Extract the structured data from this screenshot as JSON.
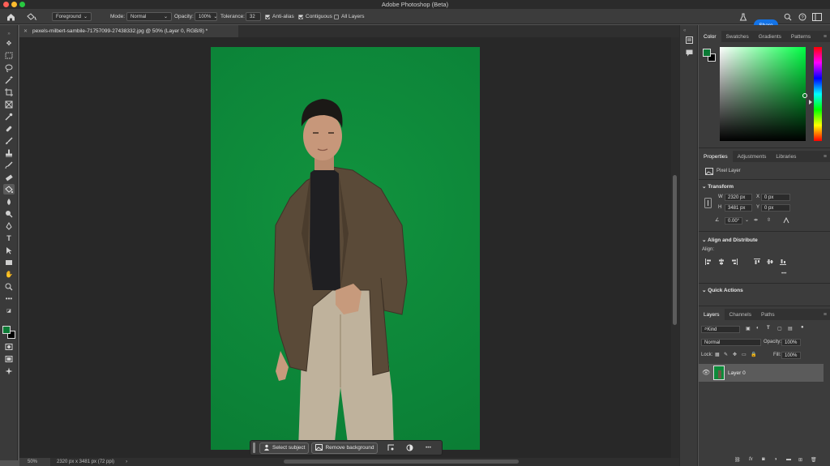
{
  "app": {
    "title": "Adobe Photoshop (Beta)"
  },
  "options": {
    "tool_preset": "Foreground",
    "mode_label": "Mode:",
    "mode_value": "Normal",
    "opacity_label": "Opacity:",
    "opacity_value": "100%",
    "tolerance_label": "Tolerance:",
    "tolerance_value": "32",
    "anti_alias": "Anti-alias",
    "contiguous": "Contiguous",
    "all_layers": "All Layers",
    "share": "Share"
  },
  "document": {
    "tab_title": "pexels-milbert-sambile-71757099-27438332.jpg @ 50% (Layer 0, RGB/8) *",
    "zoom": "50%",
    "info": "2320 px x 3481 px (72 ppi)"
  },
  "taskbar": {
    "select_subject": "Select subject",
    "remove_background": "Remove background"
  },
  "panels": {
    "color_tabs": [
      "Color",
      "Swatches",
      "Gradients",
      "Patterns"
    ],
    "props_tabs": [
      "Properties",
      "Adjustments",
      "Libraries"
    ],
    "layers_tabs": [
      "Layers",
      "Channels",
      "Paths"
    ]
  },
  "properties": {
    "kind": "Pixel Layer",
    "transform": "Transform",
    "w_label": "W",
    "w_value": "2320 px",
    "h_label": "H",
    "h_value": "3481 px",
    "x_label": "X",
    "x_value": "0 px",
    "y_label": "Y",
    "y_value": "0 px",
    "angle": "0.00°",
    "align_title": "Align and Distribute",
    "align_label": "Align:",
    "quick_actions": "Quick Actions"
  },
  "layers": {
    "filter": "Kind",
    "blend": "Normal",
    "opacity_label": "Opacity:",
    "opacity_value": "100%",
    "lock_label": "Lock:",
    "fill_label": "Fill:",
    "fill_value": "100%",
    "layer_name": "Layer 0"
  },
  "colors": {
    "foreground": "#0b7a35",
    "background": "#000000",
    "accent": "#1473e6"
  }
}
